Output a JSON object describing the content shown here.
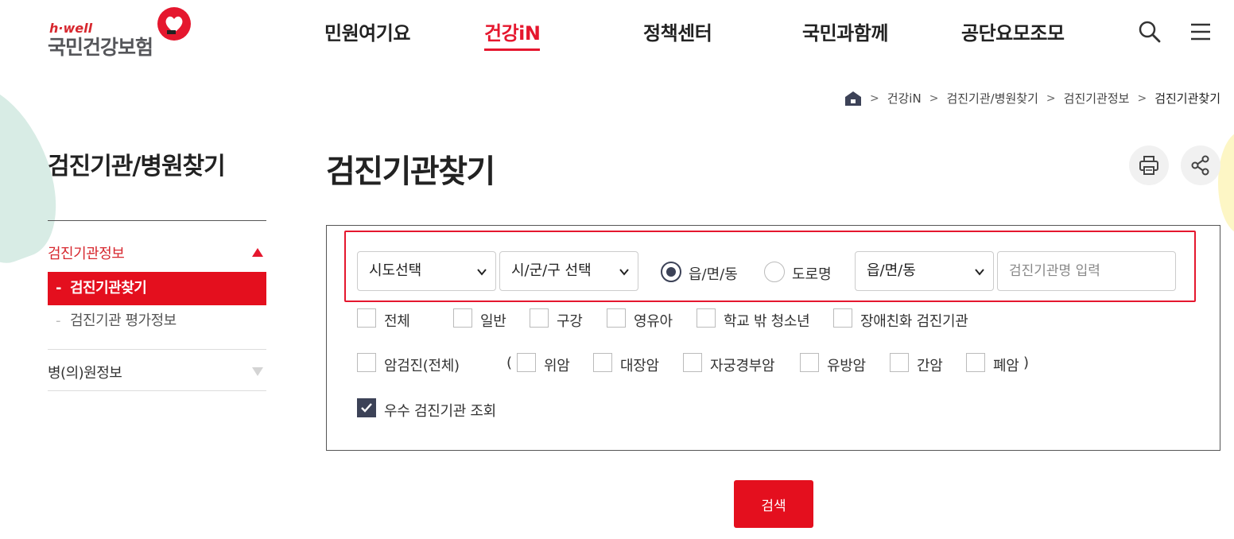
{
  "logo": {
    "brand": "h·well",
    "name": "국민건강보험"
  },
  "gnb": [
    {
      "label": "민원여기요",
      "active": false
    },
    {
      "label": "건강iN",
      "active": true
    },
    {
      "label": "정책센터",
      "active": false
    },
    {
      "label": "국민과함께",
      "active": false
    },
    {
      "label": "공단요모조모",
      "active": false
    }
  ],
  "header_icons": [
    "search-icon",
    "menu-icon"
  ],
  "breadcrumb": [
    "건강iN",
    "검진기관/병원찾기",
    "검진기관정보",
    "검진기관찾기"
  ],
  "sidebar": {
    "title": "검진기관/병원찾기",
    "sections": [
      {
        "label": "검진기관정보",
        "expanded": true,
        "items": [
          {
            "label": "검진기관찾기",
            "active": true
          },
          {
            "label": "검진기관 평가정보",
            "active": false
          }
        ]
      },
      {
        "label": "병(의)원정보",
        "expanded": false
      }
    ],
    "item_dash": "-"
  },
  "page": {
    "title": "검진기관찾기"
  },
  "search": {
    "sido": "시도선택",
    "sigungu": "시/군/구 선택",
    "radio_eupmyeondong": "읍/면/동",
    "radio_road": "도로명",
    "radio_selected": "읍/면/동",
    "dong": "읍/면/동",
    "name_placeholder": "검진기관명 입력",
    "checkboxes_row1": [
      {
        "label": "전체",
        "checked": false
      },
      {
        "label": "일반",
        "checked": false
      },
      {
        "label": "구강",
        "checked": false
      },
      {
        "label": "영유아",
        "checked": false
      },
      {
        "label": "학교 밖 청소년",
        "checked": false
      },
      {
        "label": "장애친화 검진기관",
        "checked": false
      }
    ],
    "cancer_all": {
      "label": "암검진(전체)",
      "checked": false
    },
    "paren_open": "(",
    "paren_close": ")",
    "cancer_types": [
      {
        "label": "위암",
        "checked": false
      },
      {
        "label": "대장암",
        "checked": false
      },
      {
        "label": "자궁경부암",
        "checked": false
      },
      {
        "label": "유방암",
        "checked": false
      },
      {
        "label": "간암",
        "checked": false
      },
      {
        "label": "폐암",
        "checked": false
      }
    ],
    "excellent": {
      "label": "우수 검진기관 조회",
      "checked": true
    },
    "button": "검색"
  },
  "colors": {
    "accent": "#e40f1e",
    "dark": "#3c4257"
  }
}
